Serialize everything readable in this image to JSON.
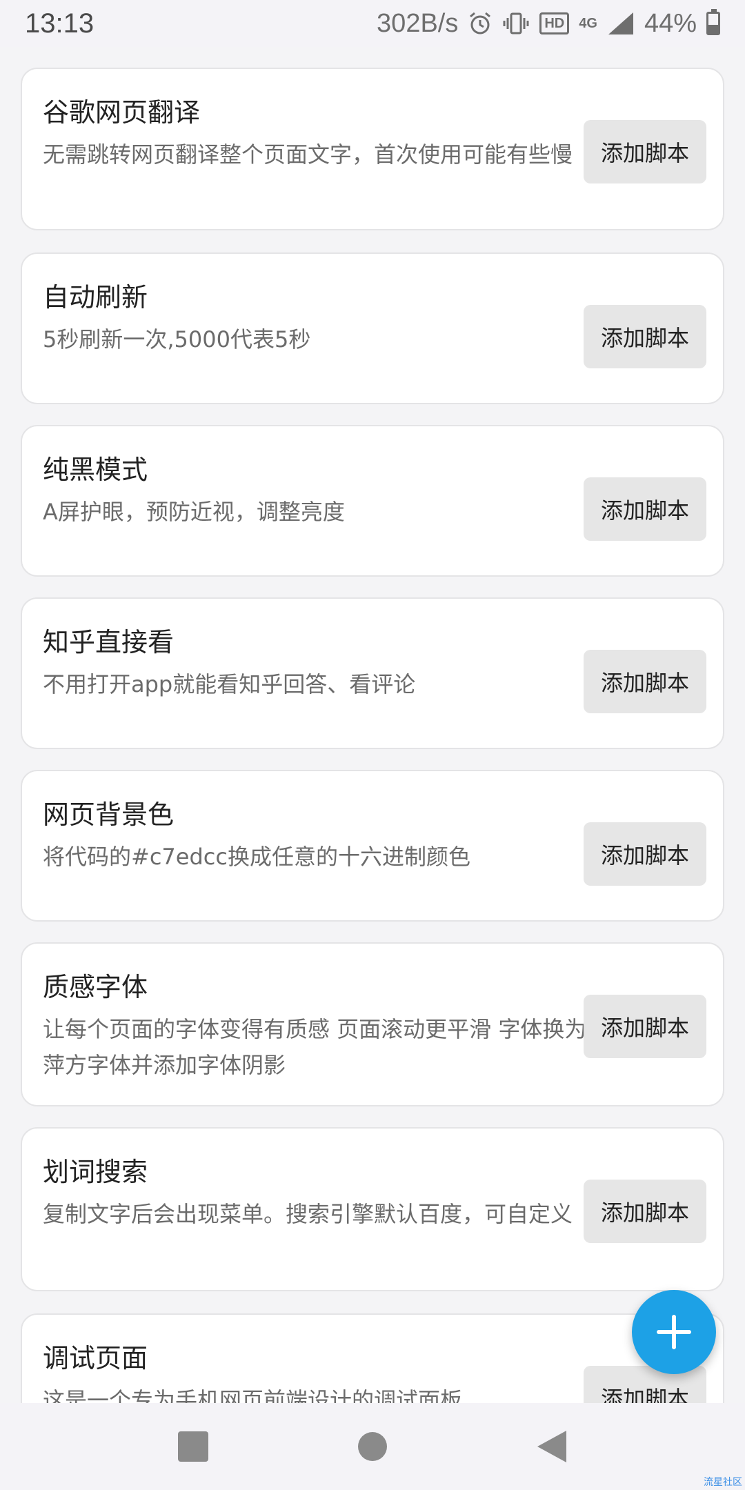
{
  "status_bar": {
    "time": "13:13",
    "net_speed": "302B/s",
    "hd_label": "HD",
    "network_type": "4G",
    "battery": "44%",
    "battery_level": 0.44
  },
  "scripts": [
    {
      "title": "谷歌网页翻译",
      "desc": "无需跳转网页翻译整个页面文字，首次使用可能有些慢",
      "button": "添加脚本"
    },
    {
      "title": "自动刷新",
      "desc": "5秒刷新一次,5000代表5秒",
      "button": "添加脚本"
    },
    {
      "title": "纯黑模式",
      "desc": "A屏护眼，预防近视，调整亮度",
      "button": "添加脚本"
    },
    {
      "title": "知乎直接看",
      "desc": "不用打开app就能看知乎回答、看评论",
      "button": "添加脚本"
    },
    {
      "title": "网页背景色",
      "desc": "将代码的#c7edcc换成任意的十六进制颜色",
      "button": "添加脚本"
    },
    {
      "title": "质感字体",
      "desc": "让每个页面的字体变得有质感 页面滚动更平滑 字体换为萍方字体并添加字体阴影",
      "button": "添加脚本"
    },
    {
      "title": "划词搜索",
      "desc": "复制文字后会出现菜单。搜索引擎默认百度，可自定义",
      "button": "添加脚本"
    },
    {
      "title": "调试页面",
      "desc": "这是一个专为手机网页前端设计的调试面板",
      "button": "添加脚本"
    }
  ],
  "fab": {
    "icon": "plus-icon",
    "color": "#1da1e6"
  },
  "nav": {
    "back_icon": "back-triangle-icon",
    "home_icon": "home-circle-icon",
    "recents_icon": "recents-square-icon"
  },
  "watermark": "流星社区"
}
